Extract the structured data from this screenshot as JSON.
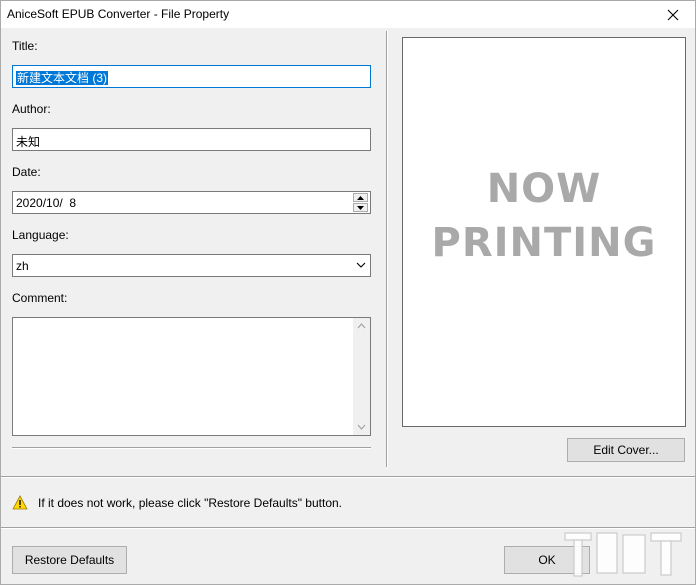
{
  "window": {
    "title": "AniceSoft EPUB Converter - File Property"
  },
  "form": {
    "title_label": "Title:",
    "title_value": "新建文本文档 (3)",
    "author_label": "Author:",
    "author_value": "未知",
    "date_label": "Date:",
    "date_value": "2020/10/  8",
    "language_label": "Language:",
    "language_value": "zh",
    "comment_label": "Comment:",
    "comment_value": ""
  },
  "cover": {
    "line1": "NOW",
    "line2": "PRINTING"
  },
  "buttons": {
    "edit_cover": "Edit Cover...",
    "restore_defaults": "Restore Defaults",
    "ok": "OK"
  },
  "notice": {
    "text": "If it does not work, please click \"Restore Defaults\" button."
  },
  "icons": {
    "close": "close-icon",
    "warning": "warning-icon",
    "spin_up": "spin-up-icon",
    "spin_down": "spin-down-icon",
    "dropdown": "chevron-down-icon"
  }
}
